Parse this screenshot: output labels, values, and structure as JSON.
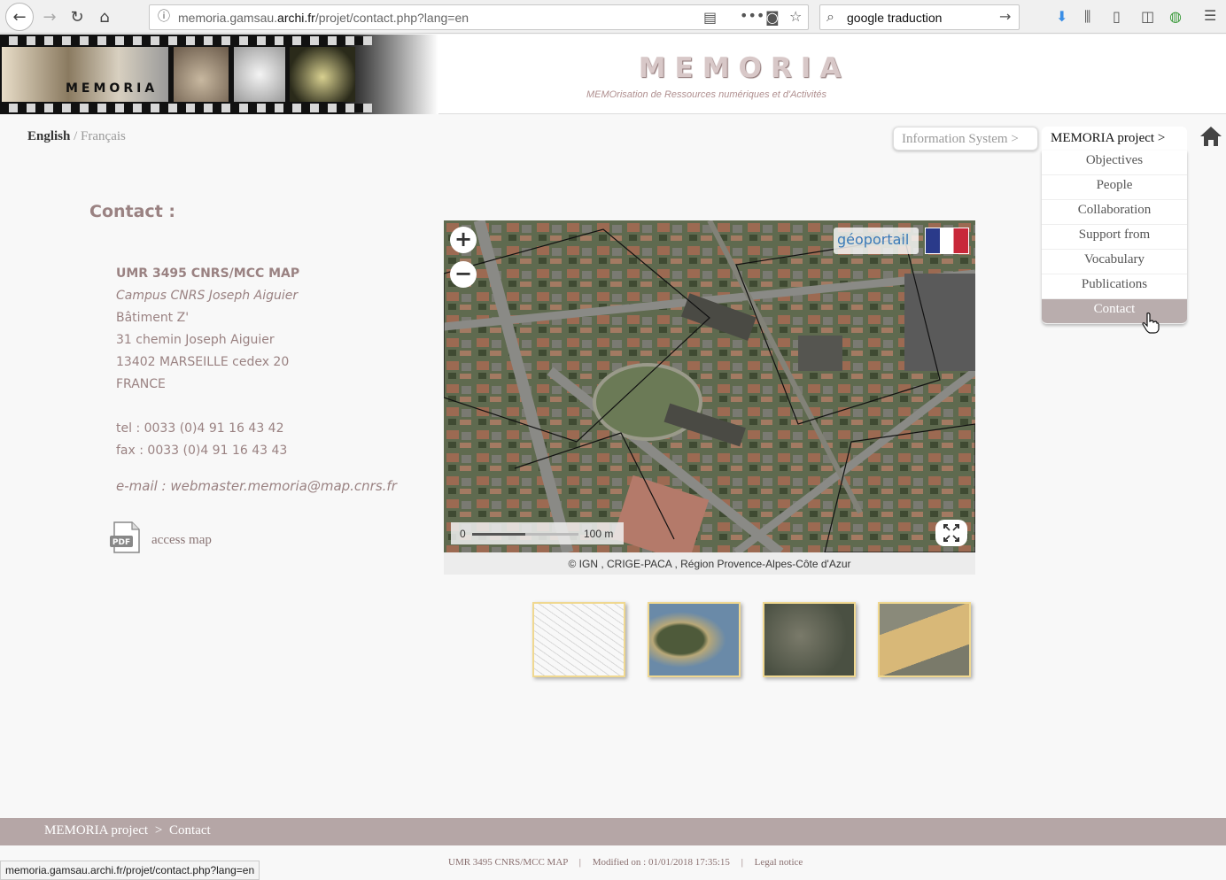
{
  "browser": {
    "url_prefix": "memoria.gamsau.",
    "url_domain": "archi.fr",
    "url_suffix": "/projet/contact.php?lang=en",
    "search_value": "google traduction",
    "status_url": "memoria.gamsau.archi.fr/projet/contact.php?lang=en"
  },
  "header": {
    "logo_text": "MEMORIA",
    "title": "MEMORIA",
    "subtitle": "MEMOrisation de Ressources numériques et d'Activités"
  },
  "language": {
    "english": "English",
    "separator": "/",
    "french": "Français"
  },
  "nav": {
    "information_system": "Information System  >",
    "memoria_project": "MEMORIA project  >",
    "items": [
      {
        "label": "Objectives"
      },
      {
        "label": "People"
      },
      {
        "label": "Collaboration"
      },
      {
        "label": "Support from"
      },
      {
        "label": "Vocabulary"
      },
      {
        "label": "Publications"
      },
      {
        "label": "Contact"
      }
    ]
  },
  "contact": {
    "title": "Contact :",
    "org": "UMR 3495 CNRS/MCC MAP",
    "campus": "Campus CNRS Joseph Aiguier",
    "building": "Bâtiment Z'",
    "street": "31 chemin Joseph Aiguier",
    "city": "13402 MARSEILLE cedex 20",
    "country": "FRANCE",
    "tel": "tel : 0033 (0)4 91 16 43 42",
    "fax": "fax : 0033 (0)4 91 16 43 43",
    "email": "e-mail : webmaster.memoria@map.cnrs.fr",
    "pdf_label": "PDF",
    "access_map": "access map"
  },
  "map": {
    "zoom_in": "+",
    "zoom_out": "−",
    "scale_start": "0",
    "scale_end": "100 m",
    "logo_text": "géoportail",
    "attribution": "© IGN  ,  CRIGE-PACA  ,  Région Provence-Alpes-Côte d'Azur"
  },
  "thumbnails": [
    {
      "name": "plan"
    },
    {
      "name": "europe"
    },
    {
      "name": "aerial"
    },
    {
      "name": "cadastre"
    }
  ],
  "footer": {
    "breadcrumb_project": "MEMORIA  project",
    "breadcrumb_sep": ">",
    "breadcrumb_page": "Contact",
    "org": "UMR 3495 CNRS/MCC MAP",
    "modified": "Modified on : 01/01/2018 17:35:15",
    "legal": "Legal notice",
    "sep": "|"
  },
  "colors": {
    "accent": "#9a8282",
    "footer_bar": "#b5a6a6",
    "active_menu": "#b9adad",
    "thumb_border": "#f0d890"
  }
}
